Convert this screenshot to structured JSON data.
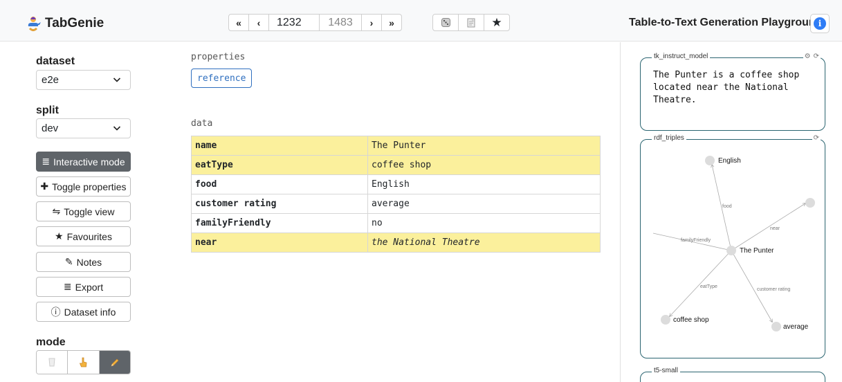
{
  "brand": {
    "name": "TabGenie",
    "icon": "genie-lamp-icon"
  },
  "pager": {
    "first": "«",
    "prev": "‹",
    "current": "1232",
    "total": "1483",
    "next": "›",
    "last": "»"
  },
  "toolbar": {
    "random_icon": "dice-icon",
    "copy_icon": "clipboard-icon",
    "favourite_icon": "★"
  },
  "header": {
    "title": "Table-to-Text Generation Playground",
    "info_icon": "i"
  },
  "sidebar": {
    "dataset_label": "dataset",
    "dataset_value": "e2e",
    "split_label": "split",
    "split_value": "dev",
    "buttons": {
      "interactive": "Interactive mode",
      "toggle_properties": "Toggle properties",
      "toggle_view": "Toggle view",
      "favourites": "Favourites",
      "notes": "Notes",
      "export": "Export",
      "dataset_info": "Dataset info"
    },
    "icons": {
      "interactive": "≣",
      "toggle_properties": "✚",
      "toggle_view": "⇋",
      "favourites": "★",
      "notes": "✎",
      "export": "≣",
      "dataset_info": "ⓘ"
    },
    "mode_label": "mode",
    "mode_icons": [
      "cup-icon",
      "pointer-hand-icon",
      "pencil-icon"
    ]
  },
  "main": {
    "properties_label": "properties",
    "reference_button": "reference",
    "data_label": "data",
    "rows": [
      {
        "key": "name",
        "value": "The Punter",
        "highlighted": true,
        "italic": false
      },
      {
        "key": "eatType",
        "value": "coffee shop",
        "highlighted": true,
        "italic": false
      },
      {
        "key": "food",
        "value": "English",
        "highlighted": false,
        "italic": false
      },
      {
        "key": "customer rating",
        "value": "average",
        "highlighted": false,
        "italic": false
      },
      {
        "key": "familyFriendly",
        "value": "no",
        "highlighted": false,
        "italic": false
      },
      {
        "key": "near",
        "value": "the National Theatre",
        "highlighted": true,
        "italic": true
      }
    ]
  },
  "outputs": [
    {
      "model": "tk_instruct_model",
      "text": "The Punter is a coffee shop located near the National Theatre."
    },
    {
      "model": "rdf_triples",
      "graph": {
        "nodes": [
          "English",
          "The Punter",
          "coffee shop",
          "average",
          ""
        ],
        "edges": [
          "food",
          "near",
          "familyFriendly",
          "eatType",
          "customer rating"
        ]
      }
    },
    {
      "model": "t5-small",
      "text": ""
    }
  ],
  "colors": {
    "highlight": "#fbf09c",
    "active": "#5f6469",
    "accent": "#2f7df6",
    "panel_border": "#2a6470"
  }
}
